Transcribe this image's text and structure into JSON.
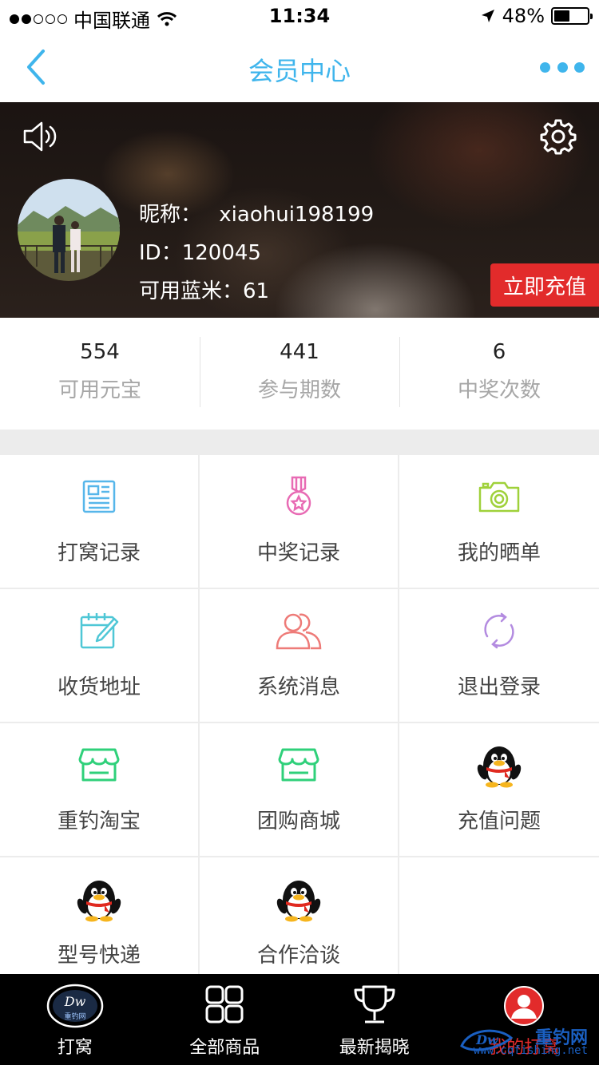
{
  "status_bar": {
    "carrier": "中国联通",
    "time": "11:34",
    "battery_text": "48%",
    "battery_level": 0.48,
    "signal_bars_filled": 2,
    "signal_bars_total": 5
  },
  "nav": {
    "title": "会员中心",
    "back_icon": "chevron-left-icon",
    "more_icon": "more-dots-icon",
    "accent_color": "#3fb5ec"
  },
  "profile": {
    "nickname_label": "昵称：",
    "nickname": "xiaohui198199",
    "id_line": "ID：120045",
    "balance_line": "可用蓝米：61",
    "recharge_label": "立即充值",
    "recharge_color": "#e22b2b"
  },
  "stats": [
    {
      "value": "554",
      "label": "可用元宝"
    },
    {
      "value": "441",
      "label": "参与期数"
    },
    {
      "value": "6",
      "label": "中奖次数"
    }
  ],
  "menu": [
    {
      "label": "打窝记录",
      "icon": "document-icon",
      "color": "#56b6ea"
    },
    {
      "label": "中奖记录",
      "icon": "medal-icon",
      "color": "#e86bb4"
    },
    {
      "label": "我的晒单",
      "icon": "camera-icon",
      "color": "#9fd13a"
    },
    {
      "label": "收货地址",
      "icon": "calendar-edit-icon",
      "color": "#4fc7d6"
    },
    {
      "label": "系统消息",
      "icon": "users-icon",
      "color": "#ee7b78"
    },
    {
      "label": "退出登录",
      "icon": "refresh-icon",
      "color": "#b38be0"
    },
    {
      "label": "重钓淘宝",
      "icon": "store-icon",
      "color": "#2fd07a"
    },
    {
      "label": "团购商城",
      "icon": "store-icon",
      "color": "#2fd07a"
    },
    {
      "label": "充值问题",
      "icon": "penguin-icon",
      "color": "#000000"
    },
    {
      "label": "型号快递",
      "icon": "penguin-icon",
      "color": "#000000"
    },
    {
      "label": "合作洽谈",
      "icon": "penguin-icon",
      "color": "#000000"
    }
  ],
  "tabs": [
    {
      "label": "打窝",
      "icon": "logo-icon"
    },
    {
      "label": "全部商品",
      "icon": "grid-icon"
    },
    {
      "label": "最新揭晓",
      "icon": "trophy-icon"
    },
    {
      "label": "我的打窝",
      "icon": "user-circle-icon"
    }
  ],
  "watermark": {
    "title": "重钓网",
    "url": "www.cqfishing.net"
  }
}
